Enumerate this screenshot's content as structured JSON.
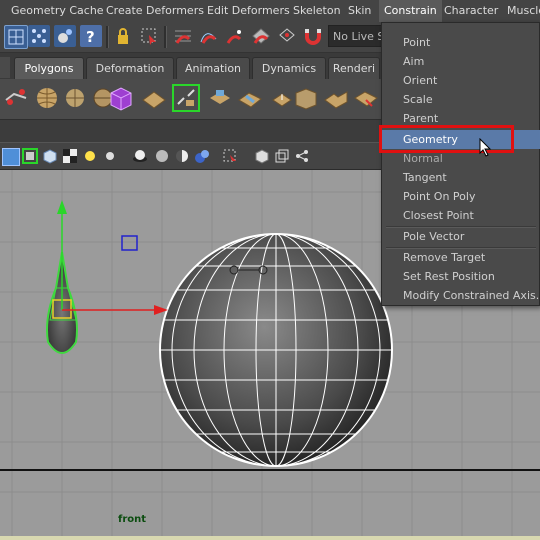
{
  "menubar": {
    "items": [
      "Geometry Cache",
      "Create Deformers",
      "Edit Deformers",
      "Skeleton",
      "Skin",
      "Constrain",
      "Character",
      "Muscle"
    ],
    "active_index": 5
  },
  "toolbar": {
    "live_surface_label": "No Live Su"
  },
  "shelf": {
    "tabs": [
      "Polygons",
      "Deformation",
      "Animation",
      "Dynamics",
      "Renderi"
    ],
    "active_index": 0
  },
  "constrain_menu": {
    "items": [
      {
        "label": "Point",
        "state": "normal"
      },
      {
        "label": "Aim",
        "state": "normal"
      },
      {
        "label": "Orient",
        "state": "normal"
      },
      {
        "label": "Scale",
        "state": "normal"
      },
      {
        "label": "Parent",
        "state": "normal"
      },
      {
        "label": "Geometry",
        "state": "highlighted"
      },
      {
        "label": "Normal",
        "state": "dim"
      },
      {
        "label": "Tangent",
        "state": "normal"
      },
      {
        "label": "Point On Poly",
        "state": "normal"
      },
      {
        "label": "Closest Point",
        "state": "normal"
      },
      {
        "label": "Pole Vector",
        "state": "normal"
      },
      {
        "label": "Remove Target",
        "state": "normal"
      },
      {
        "label": "Set Rest Position",
        "state": "normal"
      },
      {
        "label": "Modify Constrained Axis...",
        "state": "normal"
      }
    ]
  },
  "viewport": {
    "camera_label": "front"
  },
  "colors": {
    "menu_bg": "#444444",
    "highlight": "#5a7aa8",
    "callout_red": "#e01010",
    "viewport_bg": "#9b9b9b",
    "selection_green": "#3fd93f"
  },
  "icons": [
    "select-tool-icon",
    "lasso-icon",
    "paint-select-icon",
    "help-icon",
    "lock-icon",
    "snap-grid-icon",
    "snap-curve-icon",
    "snap-point-icon",
    "snap-plane-icon",
    "magnet-icon"
  ]
}
